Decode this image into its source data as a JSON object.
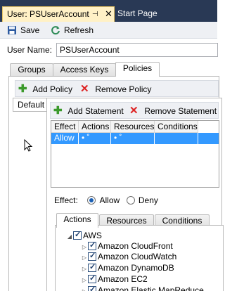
{
  "doc_tabs": {
    "active": "User: PSUserAccount",
    "pin": "⊣",
    "close": "✕",
    "other": "Start Page"
  },
  "toolbar": {
    "save": "Save",
    "refresh": "Refresh"
  },
  "user": {
    "label": "User Name:",
    "value": "PSUserAccount"
  },
  "main_tabs": [
    "Groups",
    "Access Keys",
    "Policies"
  ],
  "policy_toolbar": {
    "add": "Add Policy",
    "remove": "Remove Policy"
  },
  "policy_list": {
    "default": "Default"
  },
  "statement_toolbar": {
    "add": "Add Statement",
    "remove": "Remove Statement"
  },
  "grid": {
    "headers": [
      "Effect",
      "Actions",
      "Resources",
      "Conditions"
    ],
    "rows": [
      {
        "effect": "Allow",
        "actions": "• ˚",
        "resources": "• ˚",
        "conditions": ""
      }
    ]
  },
  "effect": {
    "label": "Effect:",
    "allow": "Allow",
    "deny": "Deny"
  },
  "sub_tabs": [
    "Actions",
    "Resources",
    "Conditions"
  ],
  "tree": {
    "root": "AWS",
    "children": [
      "Amazon CloudFront",
      "Amazon CloudWatch",
      "Amazon DynamoDB",
      "Amazon EC2",
      "Amazon Elastic MapReduce"
    ]
  },
  "colors": {
    "accent": "#3399ff",
    "doc_bg": "#293955",
    "active_tab": "#fff1c6"
  }
}
